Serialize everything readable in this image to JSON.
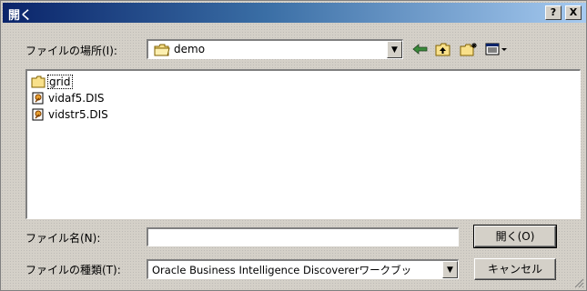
{
  "window": {
    "title": "開く",
    "help_label": "?",
    "close_label": "X"
  },
  "look_in": {
    "label": "ファイルの場所(I):",
    "value": "demo"
  },
  "toolbar": {
    "icons": [
      "back-arrow-icon",
      "up-folder-icon",
      "new-folder-icon",
      "view-menu-icon"
    ]
  },
  "files": [
    {
      "name": "grid",
      "type": "folder"
    },
    {
      "name": "vidaf5.DIS",
      "type": "dis-file"
    },
    {
      "name": "vidstr5.DIS",
      "type": "dis-file"
    }
  ],
  "filename": {
    "label": "ファイル名(N):",
    "value": ""
  },
  "filetype": {
    "label": "ファイルの種類(T):",
    "value": "Oracle Business Intelligence Discovererワークブッ"
  },
  "buttons": {
    "open": "開く(O)",
    "cancel": "キャンセル"
  },
  "colors": {
    "title_start": "#0a246a",
    "title_end": "#a6caf0",
    "face": "#d4d0c8"
  }
}
